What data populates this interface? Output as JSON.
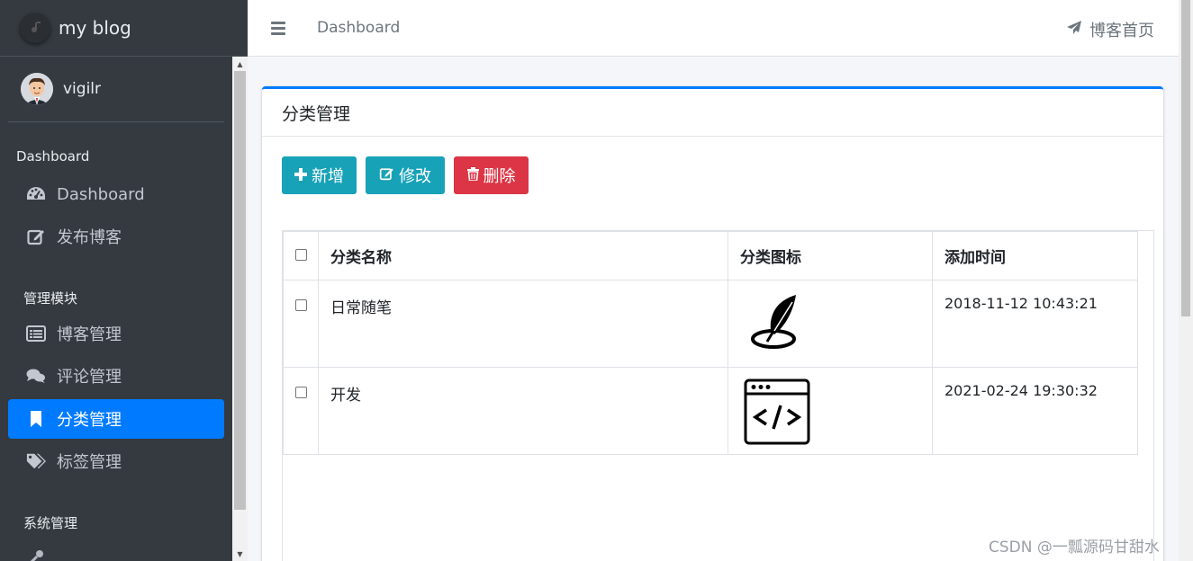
{
  "brand": {
    "title": "my blog",
    "logo_icon": "music-note-logo-icon"
  },
  "user": {
    "name": "vigilr"
  },
  "sidebar": {
    "sections": [
      {
        "header": "Dashboard",
        "items": [
          {
            "label": "Dashboard",
            "icon": "tachometer-icon"
          },
          {
            "label": "发布博客",
            "icon": "edit-icon"
          }
        ]
      },
      {
        "header": "管理模块",
        "items": [
          {
            "label": "博客管理",
            "icon": "list-alt-icon"
          },
          {
            "label": "评论管理",
            "icon": "comments-icon"
          },
          {
            "label": "分类管理",
            "icon": "bookmark-icon",
            "active": true
          },
          {
            "label": "标签管理",
            "icon": "tags-icon"
          }
        ]
      },
      {
        "header": "系统管理",
        "items": []
      }
    ],
    "active_color": "#007bff"
  },
  "navbar": {
    "breadcrumb": "Dashboard",
    "home_link": "博客首页"
  },
  "card": {
    "title": "分类管理",
    "buttons": {
      "add": "新增",
      "edit": "修改",
      "delete": "删除"
    },
    "table": {
      "headers": [
        "分类名称",
        "分类图标",
        "添加时间"
      ],
      "rows": [
        {
          "name": "日常随笔",
          "icon": "feather-quill-icon",
          "time": "2018-11-12 10:43:21"
        },
        {
          "name": "开发",
          "icon": "code-window-icon",
          "time": "2021-02-24 19:30:32"
        }
      ]
    }
  },
  "watermark": "CSDN @一瓢源码甘甜水",
  "colors": {
    "primary": "#007bff",
    "info": "#17a2b8",
    "danger": "#dc3545",
    "sidebar_bg": "#343a40"
  }
}
